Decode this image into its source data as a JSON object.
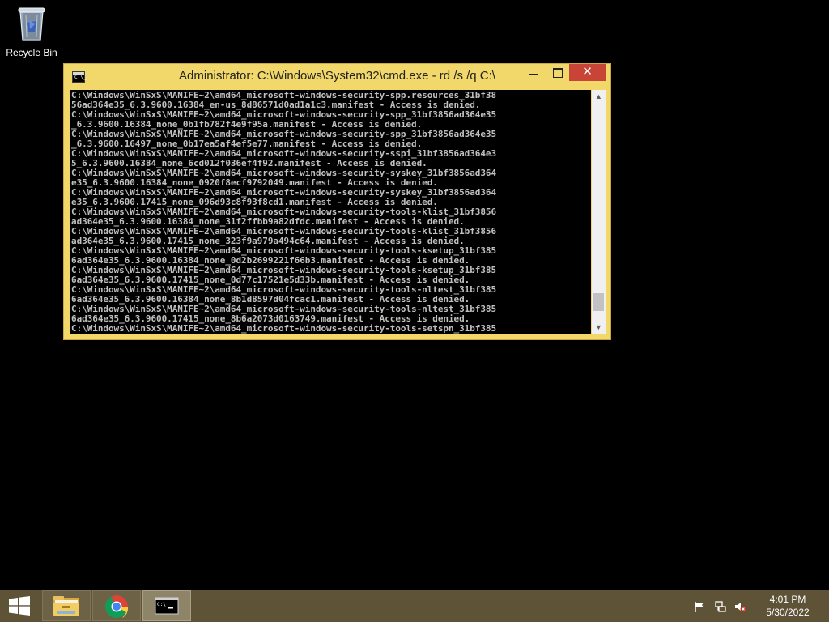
{
  "desktop": {
    "recycle_bin_label": "Recycle Bin"
  },
  "window": {
    "title": "Administrator: C:\\Windows\\System32\\cmd.exe - rd  /s /q C:\\",
    "icon_text": "C:\\_",
    "close_glyph": "✕",
    "console_lines": [
      "C:\\Windows\\WinSxS\\MANIFE~2\\amd64_microsoft-windows-security-spp.resources_31bf38",
      "56ad364e35_6.3.9600.16384_en-us_8d86571d0ad1a1c3.manifest - Access is denied.",
      "C:\\Windows\\WinSxS\\MANIFE~2\\amd64_microsoft-windows-security-spp_31bf3856ad364e35",
      "_6.3.9600.16384_none_0b1fb782f4e9f95a.manifest - Access is denied.",
      "C:\\Windows\\WinSxS\\MANIFE~2\\amd64_microsoft-windows-security-spp_31bf3856ad364e35",
      "_6.3.9600.16497_none_0b17ea5af4ef5e77.manifest - Access is denied.",
      "C:\\Windows\\WinSxS\\MANIFE~2\\amd64_microsoft-windows-security-sspi_31bf3856ad364e3",
      "5_6.3.9600.16384_none_6cd012f036ef4f92.manifest - Access is denied.",
      "C:\\Windows\\WinSxS\\MANIFE~2\\amd64_microsoft-windows-security-syskey_31bf3856ad364",
      "e35_6.3.9600.16384_none_0920f8ecf9792049.manifest - Access is denied.",
      "C:\\Windows\\WinSxS\\MANIFE~2\\amd64_microsoft-windows-security-syskey_31bf3856ad364",
      "e35_6.3.9600.17415_none_096d93c8f93f8cd1.manifest - Access is denied.",
      "C:\\Windows\\WinSxS\\MANIFE~2\\amd64_microsoft-windows-security-tools-klist_31bf3856",
      "ad364e35_6.3.9600.16384_none_31f2ffbb9a82dfdc.manifest - Access is denied.",
      "C:\\Windows\\WinSxS\\MANIFE~2\\amd64_microsoft-windows-security-tools-klist_31bf3856",
      "ad364e35_6.3.9600.17415_none_323f9a979a494c64.manifest - Access is denied.",
      "C:\\Windows\\WinSxS\\MANIFE~2\\amd64_microsoft-windows-security-tools-ksetup_31bf385",
      "6ad364e35_6.3.9600.16384_none_0d2b2699221f66b3.manifest - Access is denied.",
      "C:\\Windows\\WinSxS\\MANIFE~2\\amd64_microsoft-windows-security-tools-ksetup_31bf385",
      "6ad364e35_6.3.9600.17415_none_0d77c17521e5d33b.manifest - Access is denied.",
      "C:\\Windows\\WinSxS\\MANIFE~2\\amd64_microsoft-windows-security-tools-nltest_31bf385",
      "6ad364e35_6.3.9600.16384_none_8b1d8597d04fcac1.manifest - Access is denied.",
      "C:\\Windows\\WinSxS\\MANIFE~2\\amd64_microsoft-windows-security-tools-nltest_31bf385",
      "6ad364e35_6.3.9600.17415_none_8b6a2073d0163749.manifest - Access is denied.",
      "C:\\Windows\\WinSxS\\MANIFE~2\\amd64_microsoft-windows-security-tools-setspn_31bf385"
    ],
    "scroll_position_fraction": 0.95
  },
  "taskbar": {
    "apps": [
      {
        "name": "File Explorer",
        "icon": "folder-icon"
      },
      {
        "name": "Google Chrome",
        "icon": "chrome-icon"
      },
      {
        "name": "Command Prompt",
        "icon": "cmd-icon",
        "active": true
      }
    ],
    "tray_icons": [
      "action-center-flag-icon",
      "network-icon",
      "volume-muted-icon"
    ],
    "time": "4:01 PM",
    "date": "5/30/2022"
  },
  "colors": {
    "window_frame": "#f2d86a",
    "close_button": "#c74437",
    "taskbar": "#5e5237",
    "console_bg": "#000000",
    "console_text": "#c0c0c0"
  }
}
